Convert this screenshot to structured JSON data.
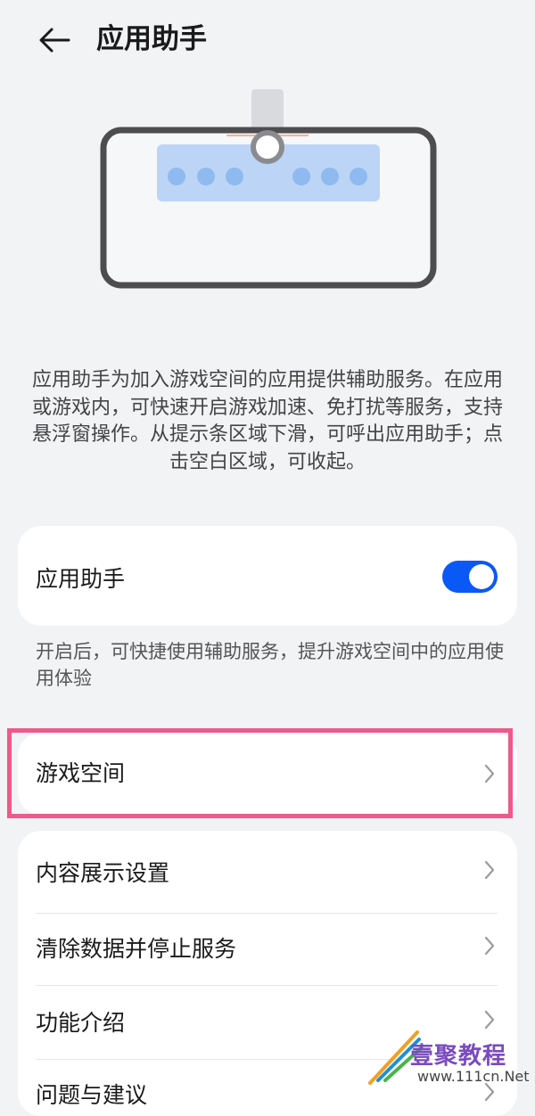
{
  "header": {
    "title": "应用助手"
  },
  "description": "应用助手为加入游戏空间的应用提供辅助服务。在应用或游戏内，可快速开启游戏加速、免打扰等服务，支持悬浮窗操作。从提示条区域下滑，可呼出应用助手；点击空白区域，可收起。",
  "toggle_card": {
    "label": "应用助手",
    "enabled": true
  },
  "toggle_note": "开启后，可快捷使用辅助服务，提升游戏空间中的应用使用体验",
  "game_space": {
    "label": "游戏空间"
  },
  "menu": {
    "items": [
      {
        "label": "内容展示设置"
      },
      {
        "label": "清除数据并停止服务"
      },
      {
        "label": "功能介绍"
      },
      {
        "label": "问题与建议"
      }
    ]
  },
  "watermark": {
    "brand": "壹聚教程",
    "url": "www.111cn.Net"
  },
  "colors": {
    "accent": "#0a59f7",
    "highlight": "#ee5a8a",
    "background": "#f1f3f5"
  }
}
